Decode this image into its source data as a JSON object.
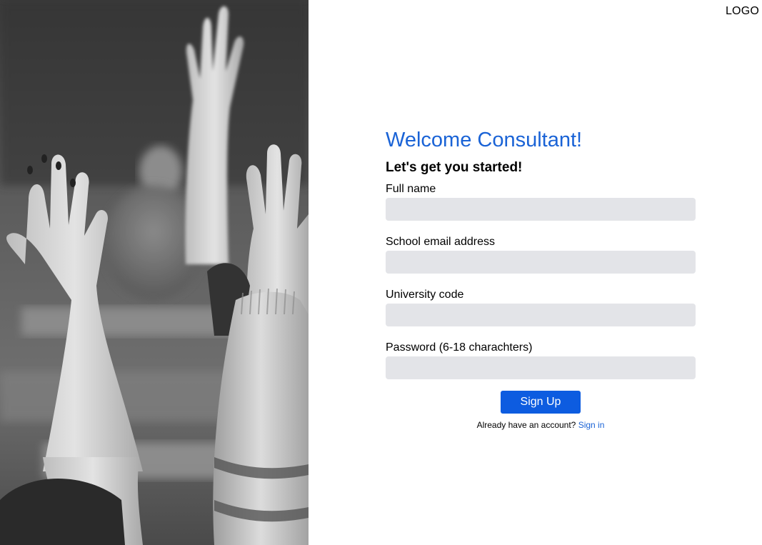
{
  "header": {
    "logo_text": "LOGO"
  },
  "hero": {
    "image_description_icon": "classroom-raised-hands-photo"
  },
  "form": {
    "title": "Welcome Consultant!",
    "subtitle": "Let's get you started!",
    "fields": [
      {
        "label": "Full name",
        "value": "",
        "placeholder": ""
      },
      {
        "label": "School email address",
        "value": "",
        "placeholder": ""
      },
      {
        "label": "University code",
        "value": "",
        "placeholder": ""
      },
      {
        "label": "Password (6-18 charachters)",
        "value": "",
        "placeholder": ""
      }
    ],
    "submit_label": "Sign Up",
    "signin_prompt": "Already have an account?",
    "signin_link": "Sign in"
  },
  "colors": {
    "accent": "#1a63d6",
    "button": "#0d5ce0",
    "input_bg": "#e3e4e8"
  }
}
